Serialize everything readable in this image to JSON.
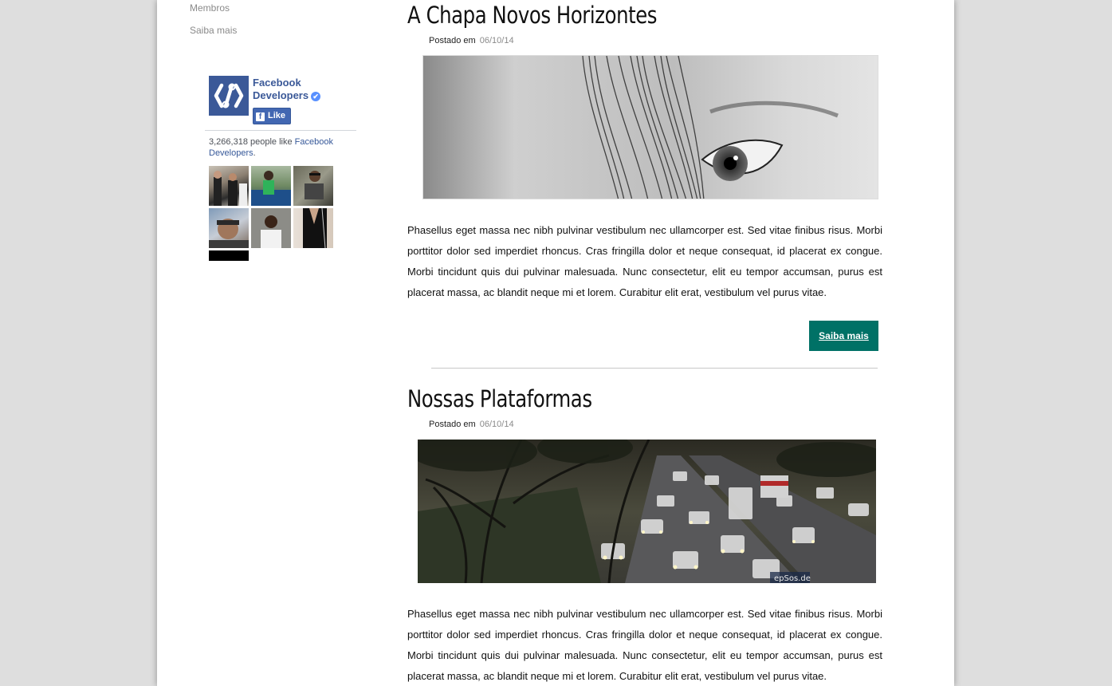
{
  "sidebar": {
    "nav": [
      {
        "label": "Membros"
      },
      {
        "label": "Saiba mais"
      }
    ],
    "facebook": {
      "page_name": "Facebook Developers",
      "verified_mark": "✔",
      "like_icon": "f",
      "like_label": "Like",
      "count_text": "3,266,318 people like ",
      "count_link": "Facebook Developers",
      "count_end": ".",
      "brand_color": "#3b5998",
      "faces": [
        {
          "label": "friend-1"
        },
        {
          "label": "friend-2"
        },
        {
          "label": "friend-3"
        },
        {
          "label": "friend-4"
        },
        {
          "label": "friend-5"
        },
        {
          "label": "friend-6"
        },
        {
          "label": "friend-7"
        }
      ]
    }
  },
  "posts": [
    {
      "title": "A Chapa Novos Horizontes",
      "posted_label": "Postado em",
      "date": "06/10/14",
      "image": "grayscale close-up of an eye behind hair",
      "body": "Phasellus eget massa nec nibh pulvinar vestibulum nec ullamcorper est. Sed vitae finibus risus. Morbi porttitor dolor sed imperdiet rhoncus. Cras fringilla dolor et neque consequat, id placerat ex congue. Morbi tincidunt quis dui pulvinar malesuada. Nunc consectetur, elit eu tempor accumsan, purus est placerat massa, ac blandit neque mi et lorem. Curabitur elit erat, vestibulum vel purus vitae.",
      "button_label": "Saiba mais",
      "button_color": "#007166"
    },
    {
      "title": "Nossas Plataformas",
      "posted_label": "Postado em",
      "date": "06/10/14",
      "image": "traffic on a tree-lined road",
      "image_watermark": "epSos.de",
      "body": "Phasellus eget massa nec nibh pulvinar vestibulum nec ullamcorper est. Sed vitae finibus risus. Morbi porttitor dolor sed imperdiet rhoncus. Cras fringilla dolor et neque consequat, id placerat ex congue. Morbi tincidunt quis dui pulvinar malesuada. Nunc consectetur, elit eu tempor accumsan, purus est placerat massa, ac blandit neque mi et lorem. Curabitur elit erat, vestibulum vel purus vitae."
    }
  ]
}
